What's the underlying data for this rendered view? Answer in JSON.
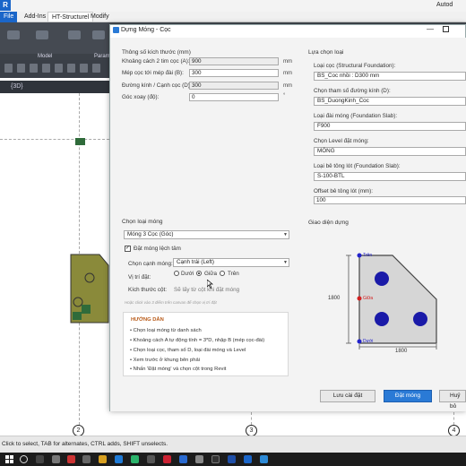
{
  "revit": {
    "logo": "R",
    "title": "Autod",
    "menu": [
      "File",
      "Add-Ins",
      "HT-Structurel",
      "Modify"
    ],
    "ribbon_panels": [
      "Model",
      "Paramet"
    ],
    "view_tab": "{3D}"
  },
  "grid_bubbles": [
    "2",
    "3",
    "4"
  ],
  "status_text": "Click to select, TAB for alternates, CTRL adds, SHIFT unselects.",
  "dialog": {
    "title": "Dựng Móng - Cọc",
    "left_params": {
      "section": "Thông số kích thước (mm)",
      "rows": [
        {
          "label": "Khoảng cách 2 tim cọc (A):",
          "value": "900",
          "unit": "mm"
        },
        {
          "label": "Mép cọc tới mép đài (B):",
          "value": "300",
          "unit": "mm"
        },
        {
          "label": "Đường kính / Cạnh cọc (D):",
          "value": "300",
          "unit": "mm"
        },
        {
          "label": "Góc xoay (độ):",
          "value": "0",
          "unit": "°"
        }
      ]
    },
    "right_select": {
      "section": "Lựa chọn loại",
      "fields": [
        {
          "label": "Loại cọc (Structural Foundation):",
          "value": "BS_Coc nhồi : D300 mm"
        },
        {
          "label": "Chọn tham số đường kính (D):",
          "value": "BS_DuongKinh_Coc"
        },
        {
          "label": "Loại đài móng (Foundation Slab):",
          "value": "F900"
        },
        {
          "label": "Chọn Level đặt móng:",
          "value": "MÓNG"
        },
        {
          "label": "Loại bê tông lót (Foundation Slab):",
          "value": "S-100-BTL"
        },
        {
          "label": "Offset bê tông lót (mm):",
          "value": "100"
        }
      ]
    },
    "foundation": {
      "section": "Chọn loại móng",
      "type_value": "Móng 3 Cọc (Góc)",
      "offset_checkbox": "Đặt móng lệch tâm",
      "edge_label": "Chọn cạnh móng:",
      "edge_value": "Cạnh trái (Left)",
      "position_label": "Vị trí đặt:",
      "positions": [
        "Dưới",
        "Giữa",
        "Trên"
      ],
      "selected_position": "Giữa",
      "column_label": "Kích thước cột:",
      "column_placeholder": "Sẽ lấy từ cột khi đặt móng",
      "hint": "Hoặc click vào 3 điểm trên canvas để chọn vị trí đặt"
    },
    "guide": {
      "title": "HƯỚNG DẪN",
      "items": [
        "• Chọn loại móng từ danh sách",
        "• Khoảng cách A tự động tính = 3*D, nhập B (mép cọc-đài)",
        "• Chọn loại cọc, tham số D, loại đài móng và Level",
        "• Xem trước ở khung bên phải",
        "• Nhấn 'Đặt móng' và chọn cột trong Revit"
      ]
    },
    "preview": {
      "section": "Giao diện dựng",
      "dim_left": "1800",
      "dim_bottom": "1800",
      "label_top": "Trên",
      "label_mid": "Giữa",
      "label_bottom": "Dưới"
    },
    "buttons": {
      "save": "Lưu cài đặt",
      "place": "Đặt móng",
      "cancel": "Huỷ bỏ"
    }
  },
  "colors": {
    "accent": "#2a7ad6",
    "pile": "#1a1aa8",
    "slab_fill": "#d6d6d6",
    "marker_blue": "#2222cc",
    "marker_red": "#d42020",
    "footing_3d": "#8a8a3a"
  }
}
